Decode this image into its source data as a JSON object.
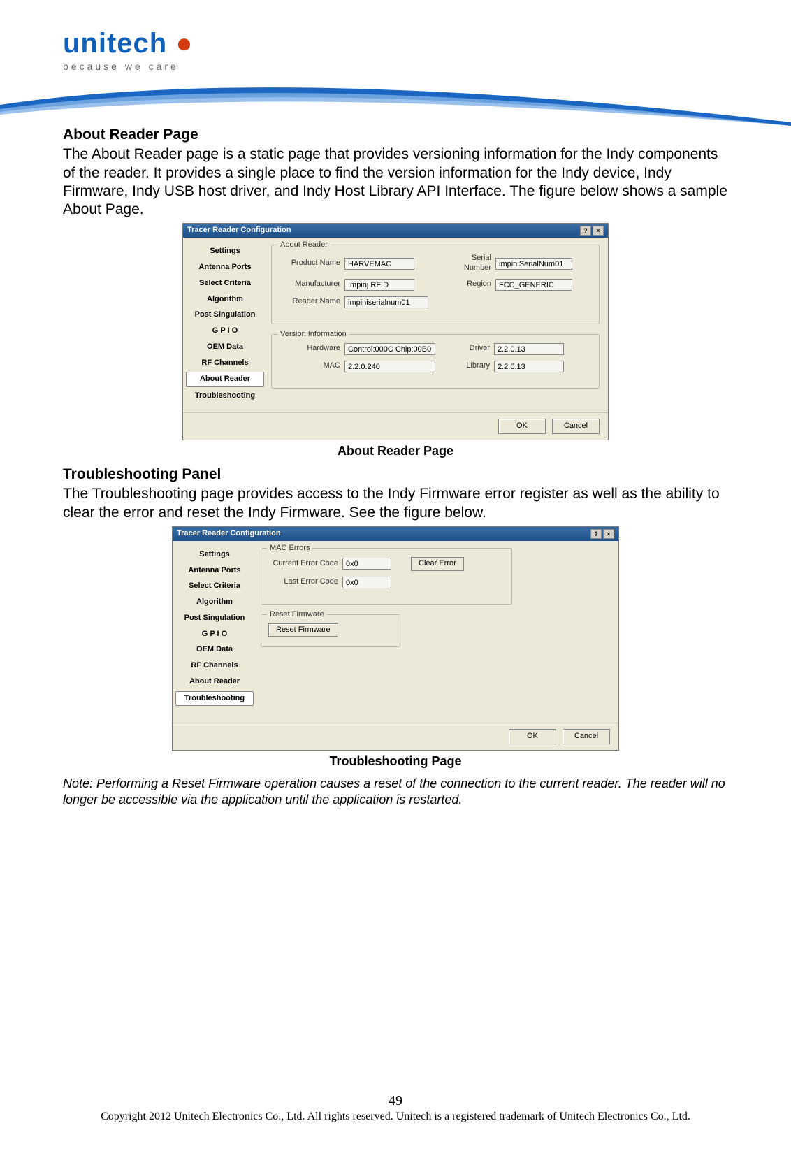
{
  "logo_main": "unitech",
  "logo_tagline": "because we care",
  "about_heading": "About Reader Page",
  "about_body": "The About Reader page is a static page that provides versioning information for the Indy components of the reader. It provides a single place to find the version information for the Indy device, Indy Firmware, Indy USB host driver, and Indy Host Library API Interface. The figure below shows a sample About Page.",
  "ts_heading": "Troubleshooting Panel",
  "ts_body": "The Troubleshooting page provides access to the Indy Firmware error register as well as the ability to clear the error and reset the Indy Firmware. See the figure below.",
  "caption1": "About Reader Page",
  "caption2": "Troubleshooting Page",
  "note": "Note: Performing a Reset Firmware operation causes a reset of the connection to the current reader. The reader will no longer be accessible via the application until the application is restarted.",
  "page_number": "49",
  "copyright": "Copyright 2012 Unitech Electronics Co., Ltd. All rights reserved. Unitech is a registered trademark of Unitech Electronics Co., Ltd.",
  "sidebar_items": [
    "Settings",
    "Antenna Ports",
    "Select Criteria",
    "Algorithm",
    "Post Singulation",
    "G P I O",
    "OEM Data",
    "RF Channels",
    "About Reader",
    "Troubleshooting"
  ],
  "dlg_title": "Tracer Reader Configuration",
  "dlg_help": "?",
  "dlg_close": "×",
  "btn_ok": "OK",
  "btn_cancel": "Cancel",
  "about_panel": {
    "group1": "About Reader",
    "group2": "Version Information",
    "product_name_lbl": "Product Name",
    "product_name_val": "HARVEMAC",
    "serial_lbl": "Serial Number",
    "serial_val": "impiniSerialNum01",
    "mfr_lbl": "Manufacturer",
    "mfr_val": "Impinj RFID",
    "region_lbl": "Region",
    "region_val": "FCC_GENERIC",
    "reader_lbl": "Reader Name",
    "reader_val": "impiniserialnum01",
    "hw_lbl": "Hardware",
    "hw_val": "Control:000C Chip:00B0",
    "driver_lbl": "Driver",
    "driver_val": "2.2.0.13",
    "mac_lbl": "MAC",
    "mac_val": "2.2.0.240",
    "lib_lbl": "Library",
    "lib_val": "2.2.0.13"
  },
  "ts_panel": {
    "group1": "MAC Errors",
    "group2": "Reset Firmware",
    "cur_lbl": "Current Error Code",
    "cur_val": "0x0",
    "last_lbl": "Last Error Code",
    "last_val": "0x0",
    "clear_btn": "Clear Error",
    "reset_btn": "Reset Firmware"
  }
}
